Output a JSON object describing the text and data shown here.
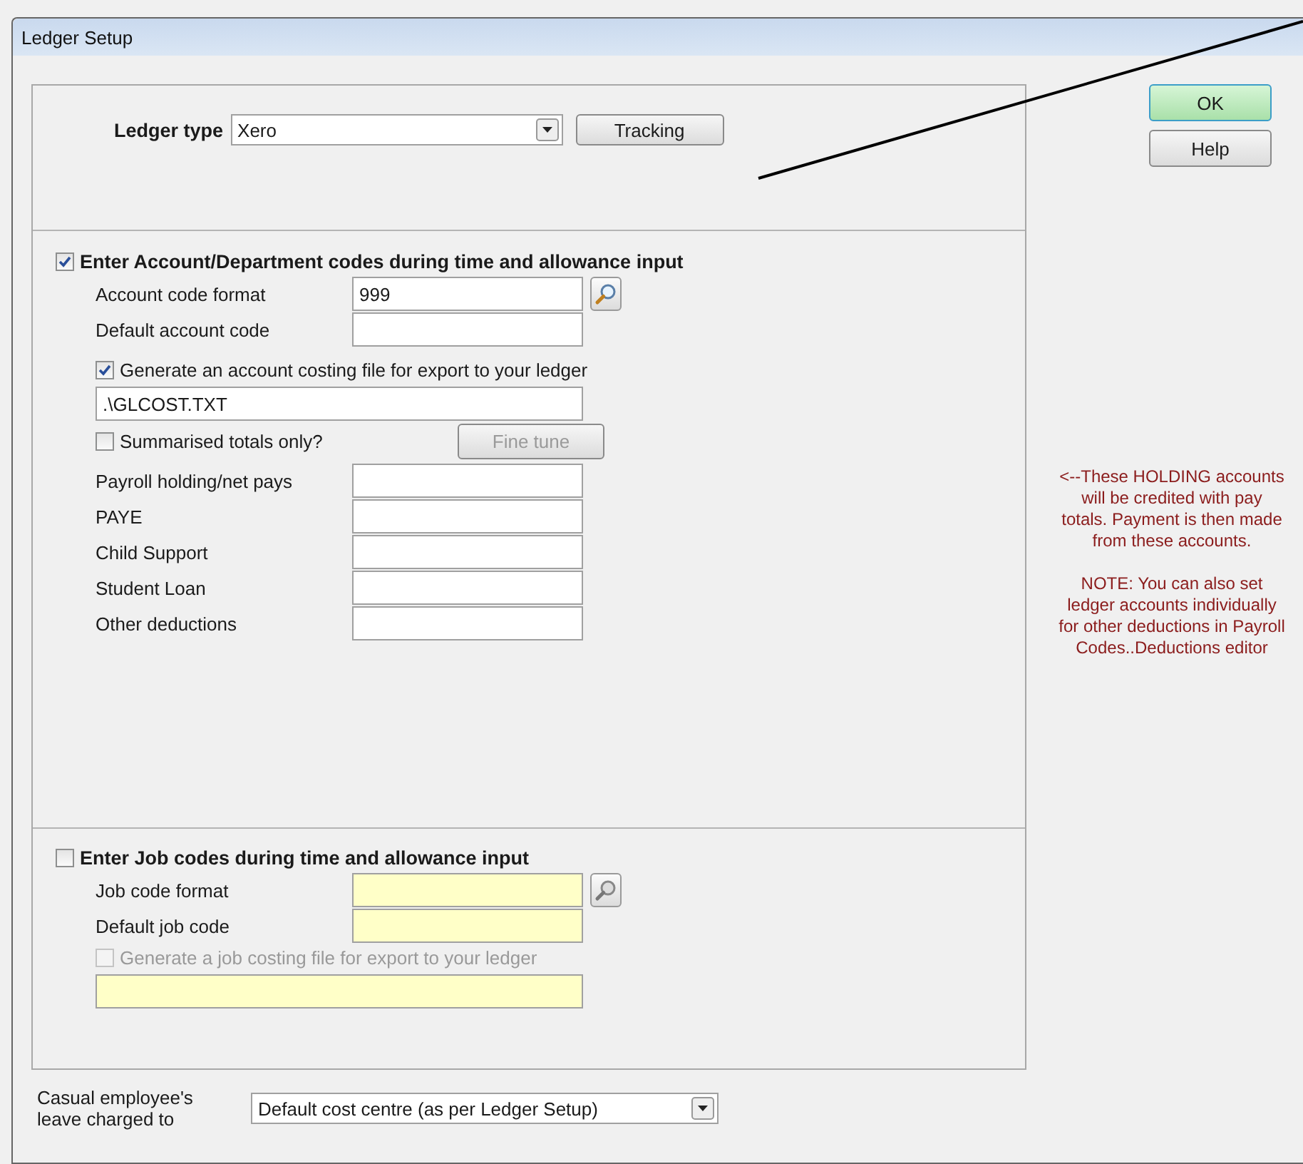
{
  "window": {
    "title": "Ledger Setup"
  },
  "ledger_type": {
    "label": "Ledger type",
    "value": "Xero",
    "tracking_button": "Tracking"
  },
  "account_section": {
    "label": "Enter Account/Department codes during time and allowance input",
    "checked": true,
    "fields": [
      {
        "label": "Account code format",
        "value": "999"
      },
      {
        "label": "Default account code"
      }
    ],
    "costing": {
      "label": "Generate an account costing file for export to your ledger",
      "checked": true,
      "path": ".\\GLCOST.TXT"
    },
    "summarised": {
      "label": "Summarised totals only?",
      "checked": false
    },
    "fine_tune": {
      "label": "Fine tune",
      "disabled": true
    },
    "holding_fields": [
      {
        "label": "Payroll holding/net pays"
      },
      {
        "label": "PAYE"
      },
      {
        "label": "Child Support"
      },
      {
        "label": "Student Loan"
      },
      {
        "label": "Other deductions"
      }
    ]
  },
  "job_section": {
    "label": "Enter Job codes during time and allowance input",
    "checked": false,
    "fields": [
      {
        "label": "Job code format"
      },
      {
        "label": "Default job code"
      }
    ],
    "costing": {
      "label": "Generate a job costing file for export to your ledger",
      "checked": false
    }
  },
  "casual_leave": {
    "label": "Casual employee's leave charged to",
    "value": "Default cost centre (as per Ledger Setup)"
  },
  "buttons": [
    {
      "label": "OK",
      "default": true
    },
    {
      "label": "Help",
      "default": false
    }
  ],
  "notes": [
    "<--These HOLDING accounts will be credited with pay totals. Payment is then made from these accounts.",
    "NOTE: You can also set ledger accounts individually for other deductions in Payroll Codes..Deductions editor"
  ]
}
